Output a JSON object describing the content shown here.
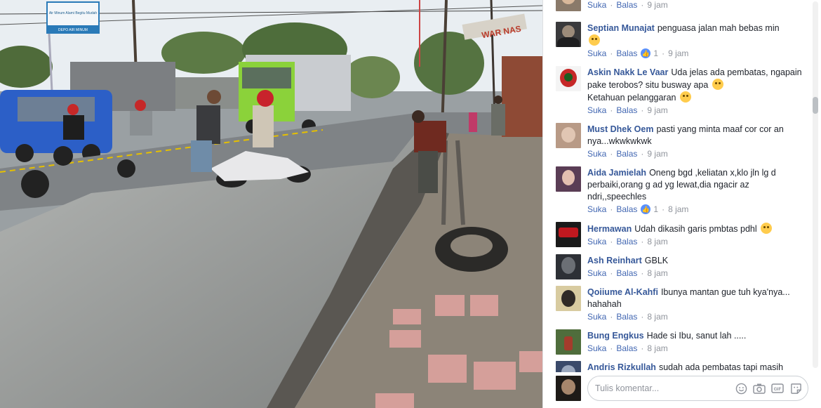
{
  "photo": {
    "sign_top": "Air Minum Alami\nBegitu Mudah",
    "sign_bottom": "DEPO AIR MINUM",
    "warung_sign": "WAR NAS"
  },
  "comments": [
    {
      "author": "",
      "text": "",
      "suka": "Suka",
      "balas": "Balas",
      "time": "9 jam",
      "likes": ""
    },
    {
      "author": "Septian Munajat",
      "text": "penguasa jalan mah bebas min",
      "suka": "Suka",
      "balas": "Balas",
      "time": "9 jam",
      "likes": "1"
    },
    {
      "author": "Askin Nakk Le Vaar",
      "text": "Uda jelas ada pembatas, ngapain pake terobos? situ busway apa",
      "text2": "Ketahuan pelanggaran",
      "suka": "Suka",
      "balas": "Balas",
      "time": "9 jam",
      "likes": ""
    },
    {
      "author": "Must Dhek Oem",
      "text": "pasti yang minta maaf cor cor an nya...wkwkwkwk",
      "suka": "Suka",
      "balas": "Balas",
      "time": "9 jam",
      "likes": ""
    },
    {
      "author": "Aida Jamielah",
      "text": "Oneng bgd ,keliatan x,klo jln lg d perbaiki,orang g ad yg lewat,dia ngacir az ndri,,speechles",
      "suka": "Suka",
      "balas": "Balas",
      "time": "8 jam",
      "likes": "1"
    },
    {
      "author": "Hermawan",
      "text": "Udah dikasih garis pmbtas pdhl",
      "suka": "Suka",
      "balas": "Balas",
      "time": "8 jam",
      "likes": ""
    },
    {
      "author": "Ash Reinhart",
      "text": "GBLK",
      "suka": "Suka",
      "balas": "Balas",
      "time": "8 jam",
      "likes": ""
    },
    {
      "author": "Qoiiume Al-Kahfi",
      "text": "Ibunya mantan gue tuh kya'nya... hahahah",
      "suka": "Suka",
      "balas": "Balas",
      "time": "8 jam",
      "likes": ""
    },
    {
      "author": "Bung Engkus",
      "text": "Hade si Ibu, sanut lah .....",
      "suka": "Suka",
      "balas": "Balas",
      "time": "8 jam",
      "likes": ""
    },
    {
      "author": "Andris Rizkullah",
      "text": "sudah ada pembatas tapi masih",
      "suka": "",
      "balas": "",
      "time": "",
      "likes": ""
    }
  ],
  "composer": {
    "placeholder": "Tulis komentar...",
    "icons": [
      "emoji-icon",
      "camera-icon",
      "gif-icon",
      "sticker-icon"
    ]
  },
  "colors": {
    "link": "#365899",
    "action": "#4267b2",
    "meta": "#90949c",
    "like": "#5890ff"
  }
}
